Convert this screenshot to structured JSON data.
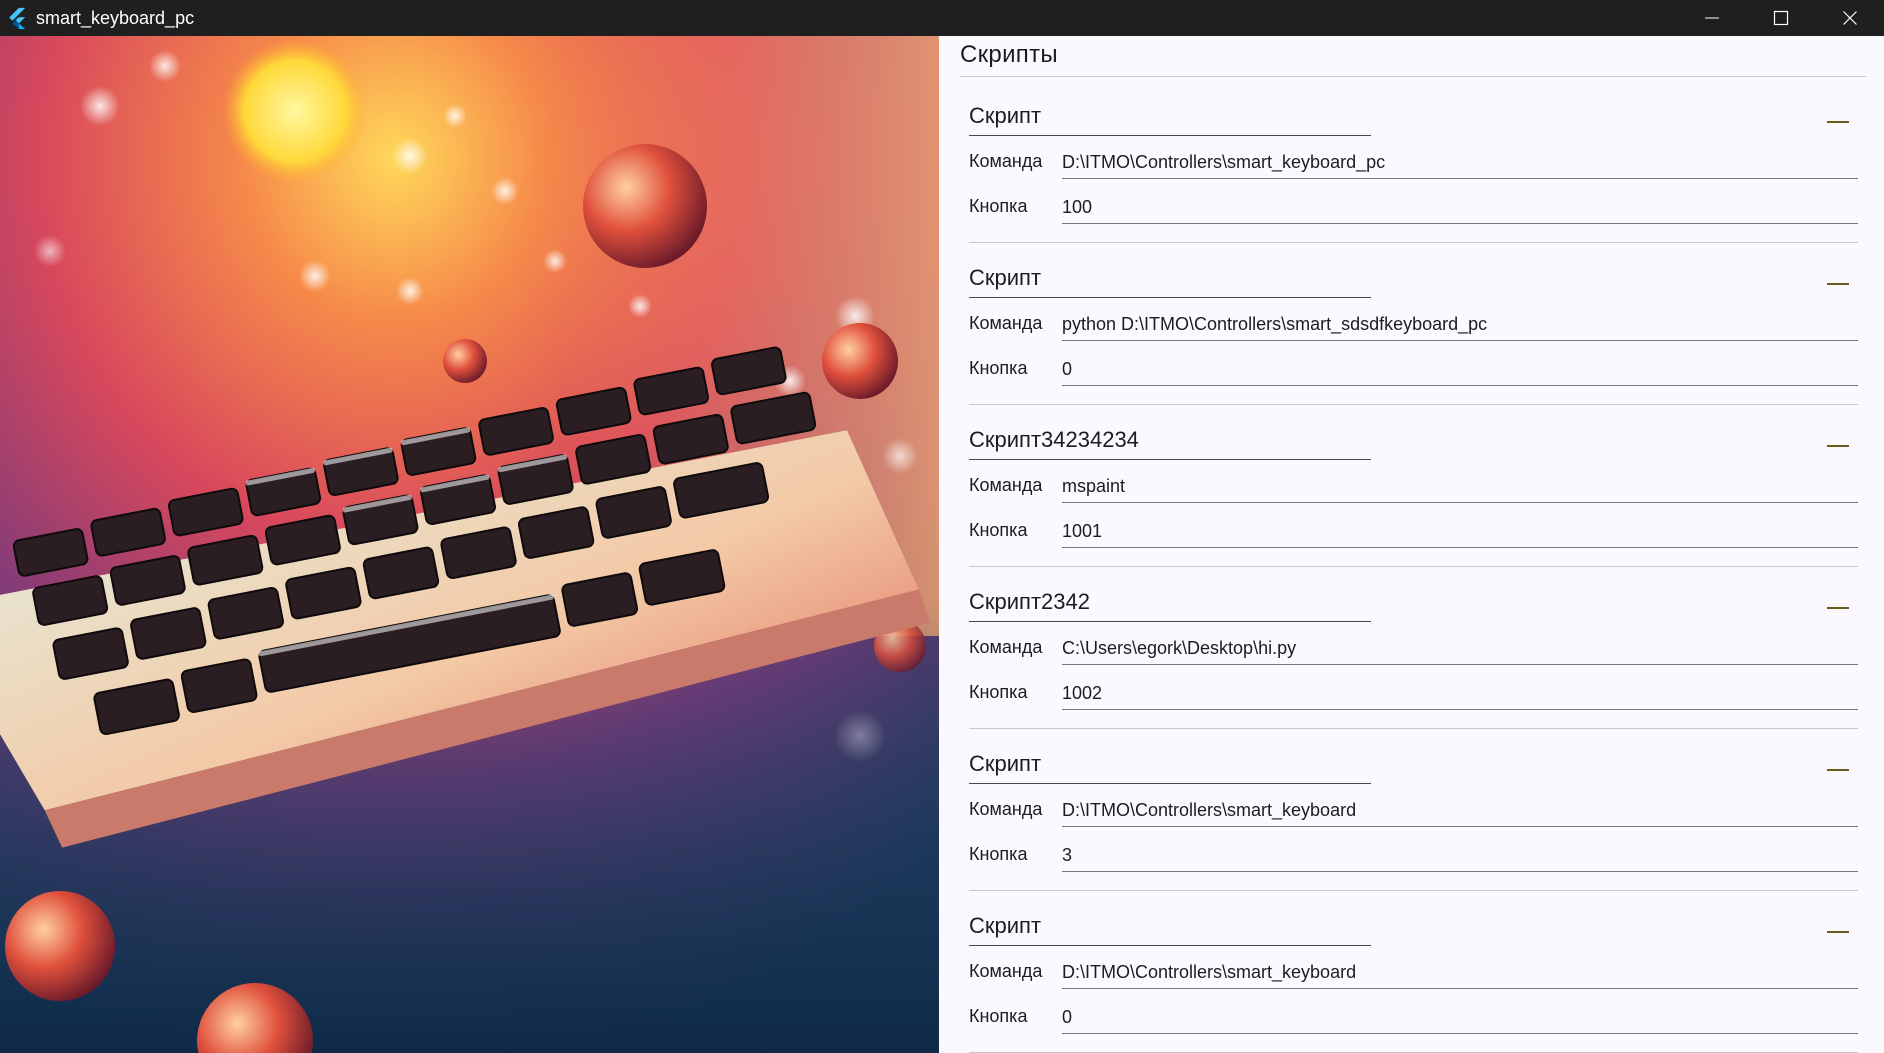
{
  "window": {
    "title": "smart_keyboard_pc",
    "icon": "flutter-logo-icon",
    "controls": [
      "minimize-icon",
      "maximize-icon",
      "close-icon"
    ]
  },
  "panel": {
    "title": "Скрипты",
    "command_label": "Команда",
    "button_label": "Кнопка"
  },
  "scripts": [
    {
      "name": "Скрипт",
      "command": "D:\\ITMO\\Controllers\\smart_keyboard_pc",
      "button": "100"
    },
    {
      "name": "Скрипт",
      "command": "python D:\\ITMO\\Controllers\\smart_sdsdfkeyboard_pc",
      "button": "0"
    },
    {
      "name": "Скрипт34234234",
      "command": "mspaint",
      "button": "1001"
    },
    {
      "name": "Скрипт2342",
      "command": "C:\\Users\\egork\\Desktop\\hi.py",
      "button": "1002"
    },
    {
      "name": "Скрипт",
      "command": "D:\\ITMO\\Controllers\\smart_keyboard",
      "button": "3"
    },
    {
      "name": "Скрипт",
      "command": "D:\\ITMO\\Controllers\\smart_keyboard",
      "button": "0"
    }
  ],
  "colors": {
    "titlebar": "#1f1f1f",
    "panel_background": "#fbf9fd",
    "remove_accent": "#6b5c1e"
  }
}
